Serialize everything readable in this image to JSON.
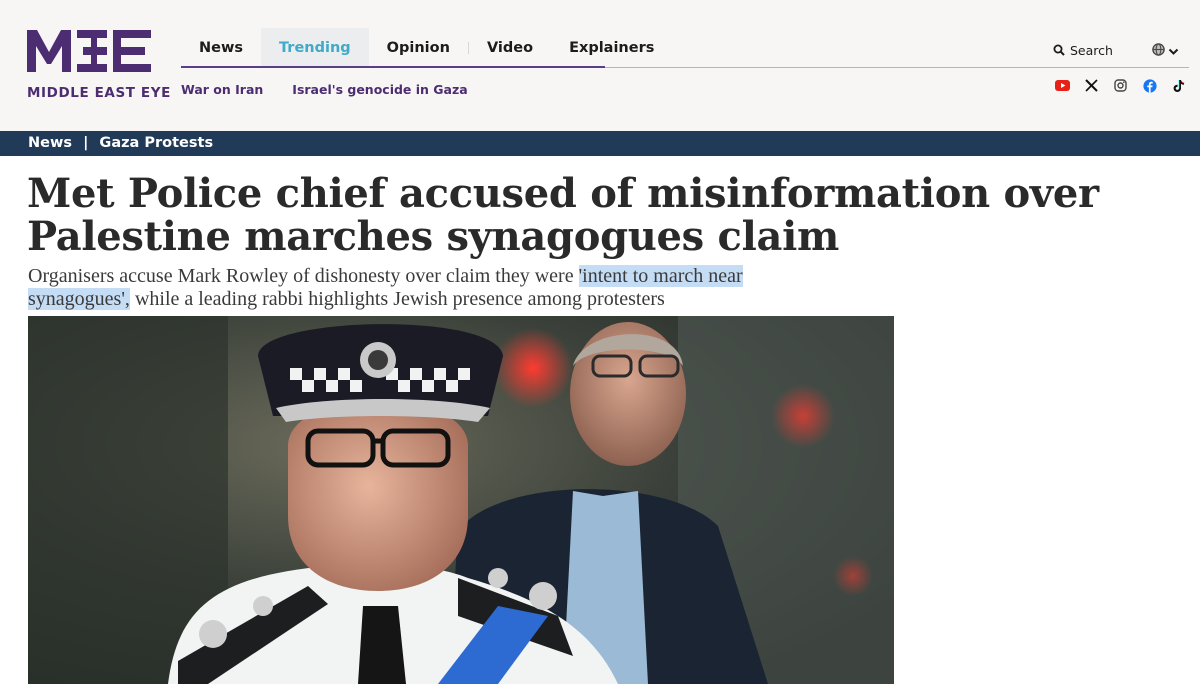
{
  "brand": {
    "logo_text": "MIDDLE EAST EYE",
    "purple": "#4d2d71",
    "accent_blue": "#41a9c9"
  },
  "header": {
    "primary_nav": [
      {
        "label": "News",
        "active": false
      },
      {
        "label": "Trending",
        "active": true
      },
      {
        "label": "Opinion",
        "active": false
      },
      {
        "label": "Video",
        "active": false
      },
      {
        "label": "Explainers",
        "active": false
      }
    ],
    "secondary_nav": [
      {
        "label": "War on Iran"
      },
      {
        "label": "Israel's genocide in Gaza"
      }
    ],
    "search_label": "Search",
    "language_icon": "globe-icon",
    "social_icons": [
      "youtube-icon",
      "x-icon",
      "instagram-icon",
      "facebook-icon",
      "tiktok-icon"
    ]
  },
  "breadcrumb": {
    "section": "News",
    "separator": "|",
    "topic": "Gaza Protests",
    "bar_color": "#213a58"
  },
  "article": {
    "headline": "Met Police chief accused of misinformation over Palestine marches synagogues claim",
    "standfirst_before": "Organisers accuse Mark Rowley of dishonesty over claim they were ",
    "standfirst_highlight": "'intent to march near synagogues',",
    "standfirst_after": " while a leading rabbi highlights Jewish presence among protesters",
    "highlight_color": "#c5dcf5"
  },
  "hero_image": {
    "subject": "police-chief-photo"
  }
}
